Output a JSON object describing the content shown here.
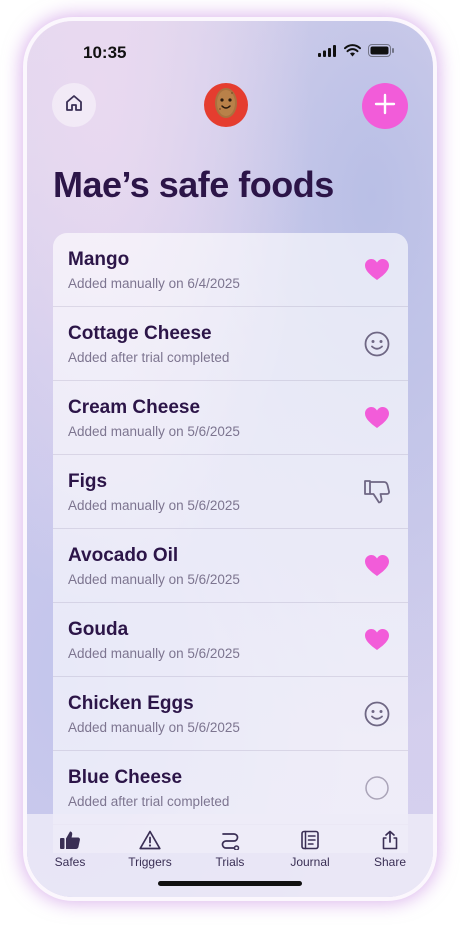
{
  "status_bar": {
    "time": "10:35"
  },
  "header": {
    "title": "Mae’s safe foods"
  },
  "colors": {
    "accent_pink": "#f25cd9",
    "title_purple": "#2c1548",
    "avatar_red": "#e53d2f"
  },
  "foods": [
    {
      "name": "Mango",
      "subtitle": "Added manually on 6/4/2025",
      "status_icon": "heart-icon"
    },
    {
      "name": "Cottage Cheese",
      "subtitle": "Added after trial completed",
      "status_icon": "smiley-icon"
    },
    {
      "name": "Cream Cheese",
      "subtitle": "Added manually on 5/6/2025",
      "status_icon": "heart-icon"
    },
    {
      "name": "Figs",
      "subtitle": "Added manually on 5/6/2025",
      "status_icon": "thumbs-down-icon"
    },
    {
      "name": "Avocado Oil",
      "subtitle": "Added manually on 5/6/2025",
      "status_icon": "heart-icon"
    },
    {
      "name": "Gouda",
      "subtitle": "Added manually on 5/6/2025",
      "status_icon": "heart-icon"
    },
    {
      "name": "Chicken Eggs",
      "subtitle": "Added manually on 5/6/2025",
      "status_icon": "smiley-icon"
    },
    {
      "name": "Blue Cheese",
      "subtitle": "Added after trial completed",
      "status_icon": "empty-circle-icon"
    }
  ],
  "tabs": [
    {
      "label": "Safes",
      "icon": "thumbs-up-icon",
      "active": true
    },
    {
      "label": "Triggers",
      "icon": "warning-icon",
      "active": false
    },
    {
      "label": "Trials",
      "icon": "path-icon",
      "active": false
    },
    {
      "label": "Journal",
      "icon": "journal-icon",
      "active": false
    },
    {
      "label": "Share",
      "icon": "share-icon",
      "active": false
    }
  ]
}
